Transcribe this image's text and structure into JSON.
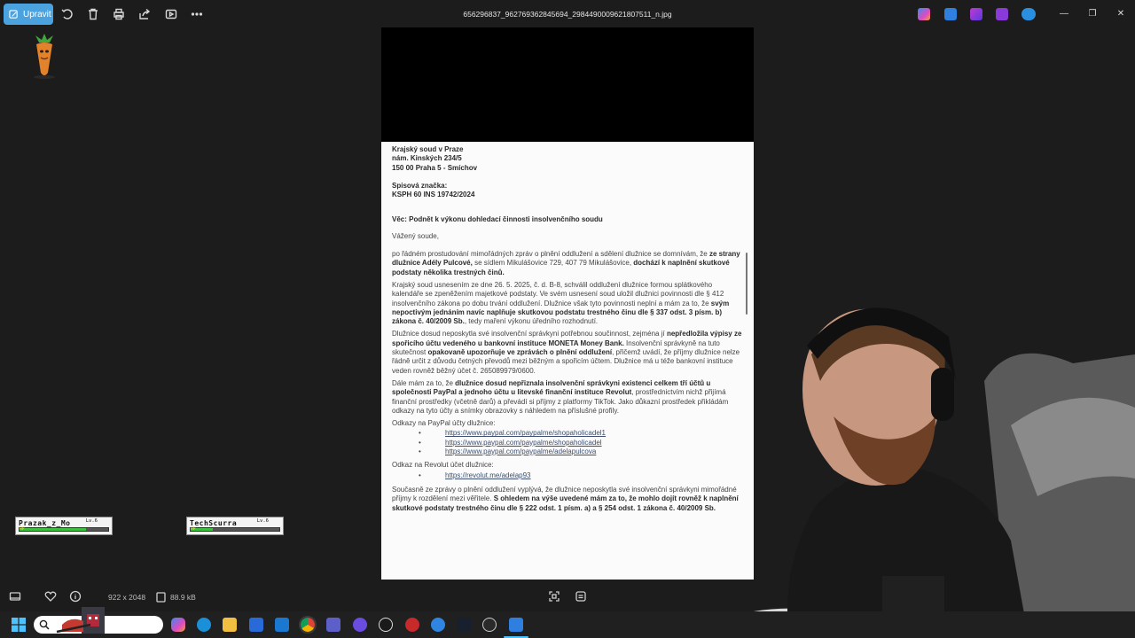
{
  "toolbar": {
    "edit_label": "Upravit",
    "filename": "656296837_962769362845694_2984490009621807511_n.jpg"
  },
  "hp_cards": [
    {
      "name": "Prazak_z_Mo",
      "level": "Lv.6",
      "hp_label": "HP",
      "hp_fraction": 0.75
    },
    {
      "name": "TechScurra",
      "level": "Lv.6",
      "hp_label": "HP",
      "hp_fraction": 0.25
    }
  ],
  "document": {
    "address": [
      "Krajský soud v Praze",
      "nám. Kinských 234/5",
      "150 00 Praha 5 - Smíchov"
    ],
    "file_label": "Spisová značka:",
    "file_number": "KSPH 60 INS 19742/2024",
    "subject": "Věc: Podnět k výkonu dohledací činnosti insolvenčního soudu",
    "salutation": "Vážený soude,",
    "p1_a": "po řádném prostudování mimořádných zpráv o plnění oddlužení a sdělení dlužnice se domnívám, že ",
    "p1_b": "ze strany dlužnice Adély Pulcové,",
    "p1_c": " se sídlem Mikulášovice 729, 407 79 Mikulášovice, ",
    "p1_d": "dochází k naplnění skutkové podstaty několika trestných činů.",
    "p2_a": "Krajský soud usnesením ze dne 26. 5. 2025, č. d. B-8, schválil oddlužení dlužnice formou splátkového kalendáře se zpeněžením majetkové podstaty. Ve svém usnesení soud uložil dlužnici povinnosti dle § 412 insolvenčního zákona po dobu trvání oddlužení. Dlužnice však tyto povinnosti neplní a mám za to, že ",
    "p2_b": "svým nepoctivým jednáním navíc naplňuje skutkovou podstatu trestného činu dle § 337 odst. 3 písm. b) zákona č. 40/2009 Sb.",
    "p2_c": ", tedy maření výkonu úředního rozhodnutí.",
    "p3_a": "Dlužnice dosud neposkytla své insolvenční správkyni potřebnou součinnost, zejména jí ",
    "p3_b": "nepředložila výpisy ze spořicího účtu vedeného u bankovní instituce MONETA Money Bank.",
    "p3_c": " Insolvenční správkyně na tuto skutečnost ",
    "p3_d": "opakovaně upozorňuje ve zprávách o plnění oddlužení",
    "p3_e": ", přičemž uvádí, že příjmy dlužnice nelze řádně určit z důvodu četných převodů mezi běžným a spořicím účtem. Dlužnice má u téže bankovní instituce veden rovněž běžný účet č. 265089979/0600.",
    "p4_a": "Dále mám za to, že ",
    "p4_b": "dlužnice dosud nepřiznala insolvenční správkyni existenci celkem tří účtů u společnosti PayPal a jednoho účtu u litevské finanční instituce Revolut",
    "p4_c": ", prostřednictvím nichž přijímá finanční prostředky (včetně darů) a převádí si příjmy z platformy TikTok. Jako důkazní prostředek přikládám odkazy na tyto účty a snímky obrazovky s náhledem na příslušné profily.",
    "paypal_label": "Odkazy na PayPal účty dlužnice:",
    "paypal_links": [
      "https://www.paypal.com/paypalme/shopaholicadel1",
      "https://www.paypal.com/paypalme/shopaholicadel",
      "https://www.paypal.com/paypalme/adelapulcova"
    ],
    "revolut_label": "Odkaz na Revolut účet dlužnice:",
    "revolut_links": [
      "https://revolut.me/adelap93"
    ],
    "p5_a": "Současně ze zprávy o plnění oddlužení vyplývá, že dlužnice neposkytla své insolvenční správkyni mimořádné příjmy k rozdělení mezi věřitele. ",
    "p5_b": "S ohledem na výše uvedené mám za to, že mohlo dojít rovněž k naplnění skutkové podstaty trestného činu dle § 222 odst. 1 písm. a) a § 254 odst. 1 zákona č. 40/2009 Sb."
  },
  "infobar": {
    "dimensions": "922 x 2048",
    "filesize": "88.9 kB"
  },
  "colors": {
    "accent": "#4aa3df",
    "background": "#1c1c1c",
    "taskbar": "#202020"
  }
}
